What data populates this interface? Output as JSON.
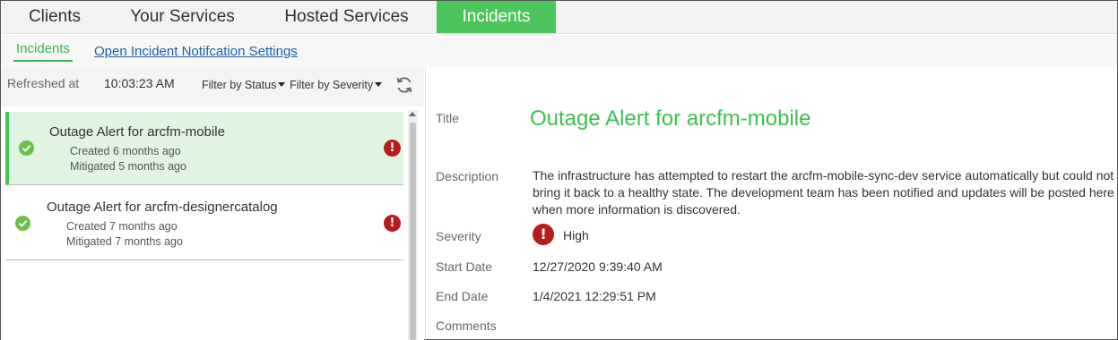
{
  "top_tabs": [
    {
      "label": "Clients",
      "active": false
    },
    {
      "label": "Your Services",
      "active": false
    },
    {
      "label": "Hosted Services",
      "active": false
    },
    {
      "label": "Incidents",
      "active": true
    }
  ],
  "subnav": {
    "active_tab": "Incidents",
    "settings_link": "Open Incident Notifcation Settings"
  },
  "toolbar": {
    "refreshed_label": "Refreshed at",
    "refreshed_time": "10:03:23 AM",
    "filter_status": "Filter by Status",
    "filter_severity": "Filter by Severity",
    "refresh_icon": "refresh-icon"
  },
  "incidents": [
    {
      "title": "Outage Alert for arcfm-mobile",
      "created": "Created 6 months ago",
      "mitigated": "Mitigated 5 months ago",
      "status_icon": "check-circle-icon",
      "severity_icon": "alert-icon",
      "selected": true
    },
    {
      "title": "Outage Alert for arcfm-designercatalog",
      "created": "Created 7 months ago",
      "mitigated": "Mitigated 7 months ago",
      "status_icon": "check-circle-icon",
      "severity_icon": "alert-icon",
      "selected": false
    }
  ],
  "detail": {
    "labels": {
      "title": "Title",
      "description": "Description",
      "severity": "Severity",
      "start_date": "Start Date",
      "end_date": "End Date",
      "comments": "Comments"
    },
    "title": "Outage Alert for arcfm-mobile",
    "description": "The infrastructure has attempted to restart the arcfm-mobile-sync-dev service automatically but could not bring it back to a healthy state.  The development team has been notified and updates will be posted here when more information is discovered.",
    "severity": "High",
    "start_date": "12/27/2020 9:39:40 AM",
    "end_date": "1/4/2021 12:29:51 PM"
  },
  "colors": {
    "accent_green": "#4cc65a",
    "title_green": "#3dbf4f",
    "alert_red": "#b71c1c",
    "link_blue": "#1a5faa",
    "selected_bg": "#dff5e2"
  }
}
